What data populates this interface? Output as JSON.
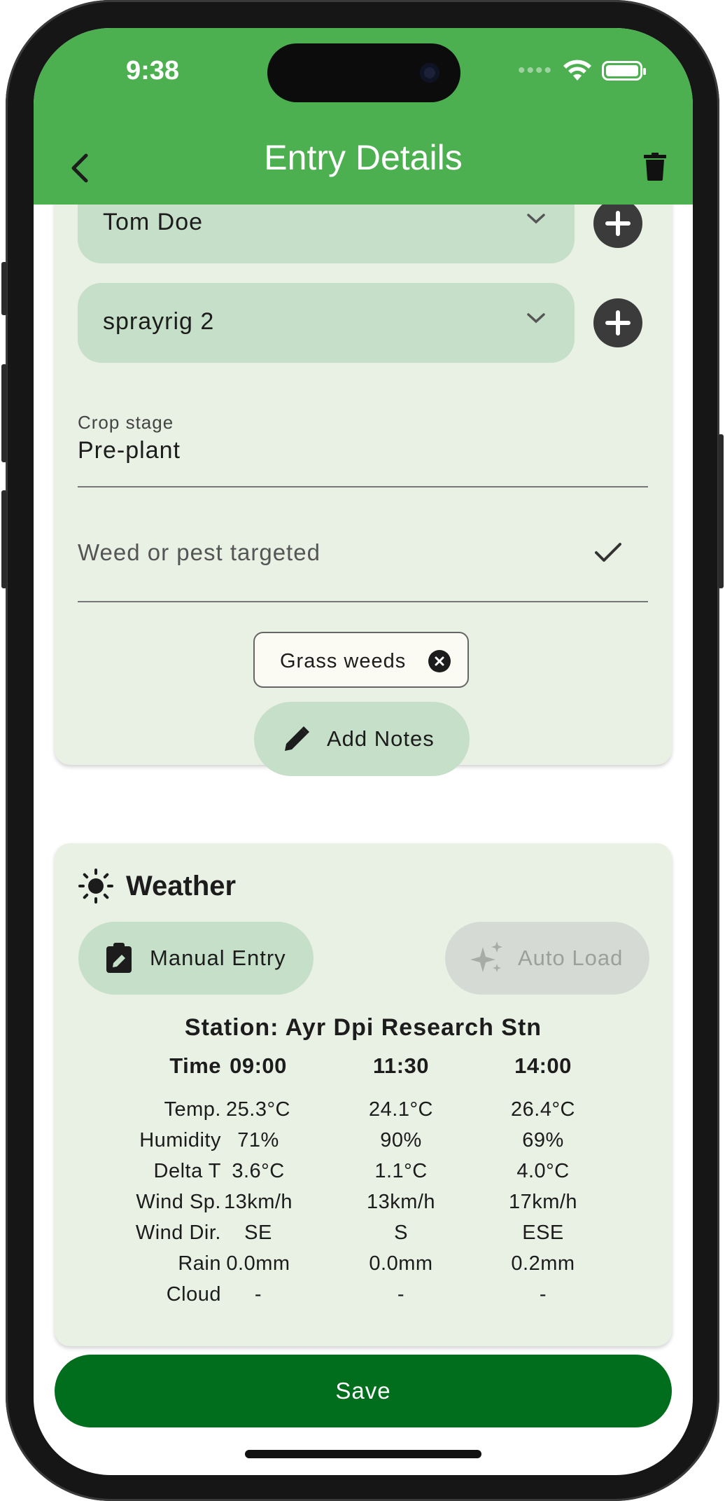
{
  "status_bar": {
    "time": "9:38"
  },
  "app_bar": {
    "title": "Entry Details"
  },
  "form": {
    "operator_value": "Tom Doe",
    "equipment_value": "sprayrig 2",
    "crop_stage_label": "Crop stage",
    "crop_stage_value": "Pre-plant",
    "weed_placeholder": "Weed or pest targeted",
    "selected_chip": "Grass weeds",
    "add_notes_label": "Add Notes"
  },
  "weather": {
    "title": "Weather",
    "manual_label": "Manual Entry",
    "auto_label": "Auto Load",
    "station": "Station: Ayr Dpi Research Stn",
    "header_label": "Time",
    "times": [
      "09:00",
      "11:30",
      "14:00"
    ],
    "rows": [
      {
        "label": "Temp.",
        "values": [
          "25.3°C",
          "24.1°C",
          "26.4°C"
        ]
      },
      {
        "label": "Humidity",
        "values": [
          "71%",
          "90%",
          "69%"
        ]
      },
      {
        "label": "Delta T",
        "values": [
          "3.6°C",
          "1.1°C",
          "4.0°C"
        ]
      },
      {
        "label": "Wind Sp.",
        "values": [
          "13km/h",
          "13km/h",
          "17km/h"
        ]
      },
      {
        "label": "Wind Dir.",
        "values": [
          "SE",
          "S",
          "ESE"
        ]
      },
      {
        "label": "Rain",
        "values": [
          "0.0mm",
          "0.0mm",
          "0.2mm"
        ]
      },
      {
        "label": "Cloud",
        "values": [
          "-",
          "-",
          "-"
        ]
      }
    ]
  },
  "save_label": "Save",
  "colors": {
    "app_bar": "#4caf50",
    "save_button": "#006e1c",
    "card": "#e9f0e4",
    "tonal": "#c6dfc8"
  },
  "icons": [
    "back-arrow-icon",
    "trash-icon",
    "chevron-down-icon",
    "plus-icon",
    "check-icon",
    "close-circle-icon",
    "pencil-icon",
    "sun-icon",
    "clipboard-edit-icon",
    "sparkles-icon",
    "wifi-icon",
    "battery-icon"
  ]
}
